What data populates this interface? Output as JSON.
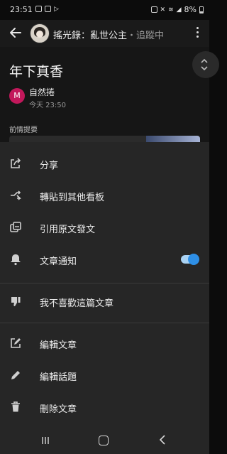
{
  "status_bar": {
    "time": "23:51",
    "battery": "8%"
  },
  "header": {
    "title": "搖光錄：亂世公主",
    "follow_text": "・追蹤中"
  },
  "post": {
    "title": "年下真香",
    "author_initial": "M",
    "author_name": "自然捲",
    "time": "今天 23:50",
    "preview_label": "前情提要"
  },
  "menu": {
    "items": [
      {
        "label": "分享",
        "icon": "share-icon"
      },
      {
        "label": "轉貼到其他看板",
        "icon": "repost-icon"
      },
      {
        "label": "引用原文發文",
        "icon": "quote-icon"
      },
      {
        "label": "文章通知",
        "icon": "bell-icon",
        "toggle": true
      },
      {
        "label": "我不喜歡這篇文章",
        "icon": "thumbs-down-icon"
      },
      {
        "label": "編輯文章",
        "icon": "edit-box-icon"
      },
      {
        "label": "編輯話題",
        "icon": "pencil-icon"
      },
      {
        "label": "刪除文章",
        "icon": "trash-icon"
      }
    ],
    "toggle_color": "#2e8fe6"
  },
  "nav": {
    "recent": "recent-apps-icon",
    "home": "home-icon",
    "back": "back-icon"
  }
}
